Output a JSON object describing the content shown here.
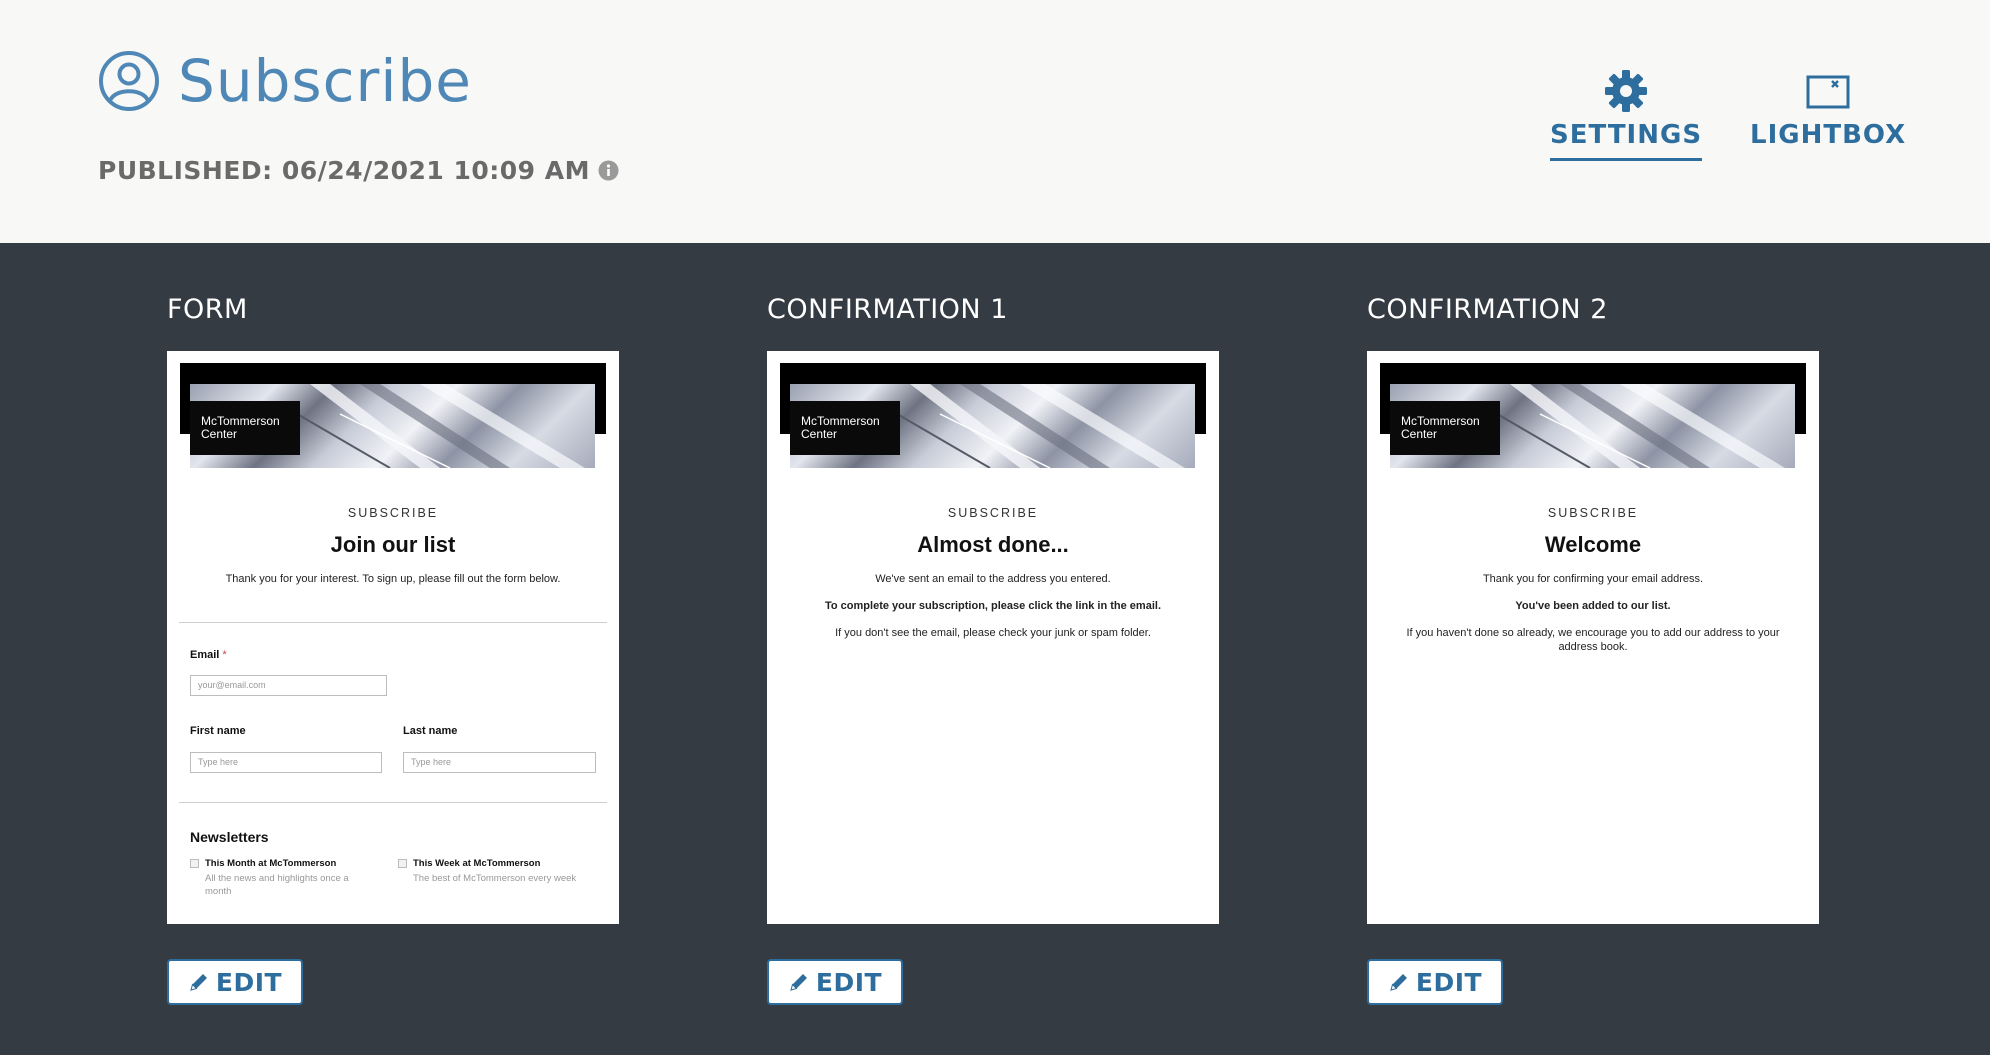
{
  "header": {
    "title": "Subscribe",
    "published": "PUBLISHED: 06/24/2021 10:09 AM",
    "title_icon": "user-circle-icon",
    "info_icon": "info-icon"
  },
  "toolbar": {
    "settings_label": "SETTINGS",
    "settings_icon": "gear-icon",
    "lightbox_label": "LIGHTBOX",
    "lightbox_icon": "lightbox-icon"
  },
  "colors": {
    "accent": "#2d6e9e",
    "title_blue": "#4f88b6",
    "dark_bg": "#353b43",
    "header_bg": "#f8f8f6"
  },
  "panels": [
    {
      "title": "FORM",
      "kicker": "SUBSCRIBE",
      "heading": "Join our list",
      "intro": "Thank you for your interest. To sign up, please fill out the form below.",
      "logo": "McTommerson Center",
      "email_label": "Email",
      "email_required": "*",
      "email_placeholder": "your@email.com",
      "first_name_label": "First name",
      "first_name_placeholder": "Type here",
      "last_name_label": "Last name",
      "last_name_placeholder": "Type here",
      "newsletters_title": "Newsletters",
      "newsletters": [
        {
          "title": "This Month at McTommerson",
          "desc": "All the news and highlights once a month"
        },
        {
          "title": "This Week at McTommerson",
          "desc": "The best of McTommerson every week"
        }
      ],
      "edit_label": "EDIT"
    },
    {
      "title": "CONFIRMATION 1",
      "kicker": "SUBSCRIBE",
      "heading": "Almost done...",
      "logo": "McTommerson Center",
      "lines": [
        {
          "text": "We've sent an email to the address you entered.",
          "bold": false
        },
        {
          "text": "To complete your subscription, please click the link in the email.",
          "bold": true
        },
        {
          "text": "If you don't see the email, please check your junk or spam folder.",
          "bold": false
        }
      ],
      "edit_label": "EDIT"
    },
    {
      "title": "CONFIRMATION 2",
      "kicker": "SUBSCRIBE",
      "heading": "Welcome",
      "logo": "McTommerson Center",
      "lines": [
        {
          "text": "Thank you for confirming your email address.",
          "bold": false
        },
        {
          "text": "You've been added to our list.",
          "bold": true
        },
        {
          "text": "If you haven't done so already, we encourage you to add our address to your address book.",
          "bold": false
        }
      ],
      "edit_label": "EDIT"
    }
  ]
}
